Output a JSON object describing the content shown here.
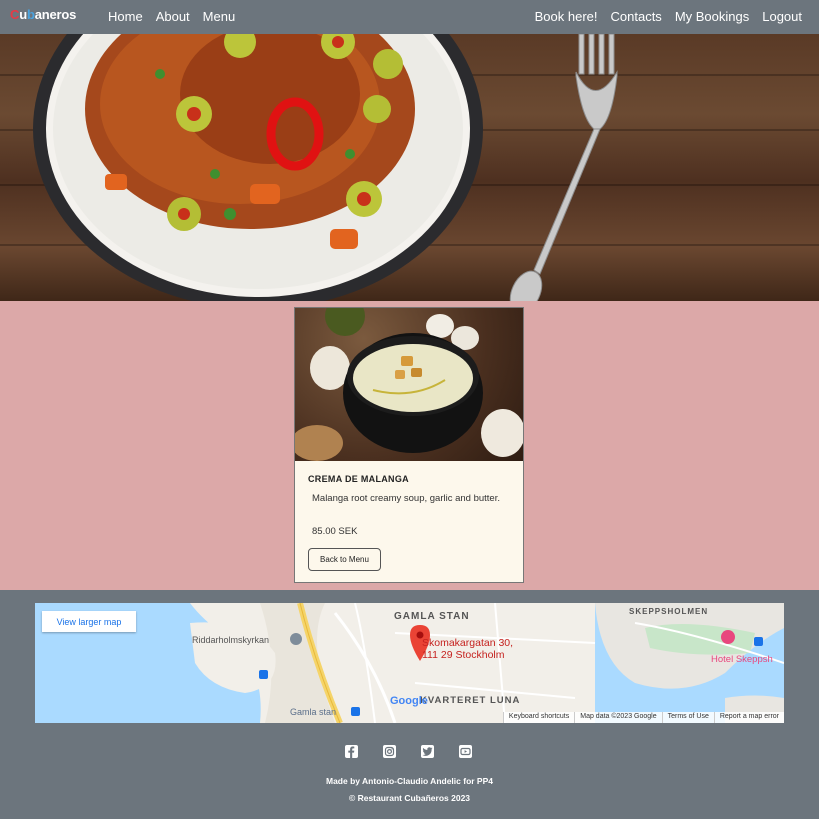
{
  "nav": {
    "brand": {
      "c": "C",
      "u": "u",
      "b": "b",
      "rest": "aneros"
    },
    "left_links": [
      "Home",
      "About",
      "Menu"
    ],
    "right_links": [
      "Book here!",
      "Contacts",
      "My Bookings",
      "Logout"
    ]
  },
  "card": {
    "title": "CREMA DE MALANGA",
    "description": "Malanga root creamy soup, garlic and butter.",
    "price": "85.00 SEK",
    "button": "Back to Menu"
  },
  "map": {
    "view_larger": "View larger map",
    "labels": {
      "gamla_stan": "GAMLA STAN",
      "skeppsholmen": "SKEPPSHOLMEN",
      "riddarholmskyrkan": "Riddarholmskyrkan",
      "kvarteret_luna": "KVARTERET LUNA",
      "gamla_stan_station": "Gamla stan",
      "hotel": "Hotel Skeppsh",
      "address_line1": "Skomakargatan 30,",
      "address_line2": "111 29 Stockholm",
      "google": "Google"
    },
    "footer": [
      "Keyboard shortcuts",
      "Map data ©2023 Google",
      "Terms of Use",
      "Report a map error"
    ]
  },
  "footer": {
    "socials": [
      "facebook-icon",
      "instagram-icon",
      "twitter-icon",
      "youtube-icon"
    ],
    "made_by": "Made by Antonio-Claudio Andelic for PP4",
    "copyright": "© Restaurant Cubañeros 2023"
  },
  "colors": {
    "nav_bg": "#6c757d",
    "content_bg": "#dca8a8",
    "card_bg": "#fdf8ec",
    "brand_red": "#e63946",
    "brand_blue": "#4aa3df"
  }
}
